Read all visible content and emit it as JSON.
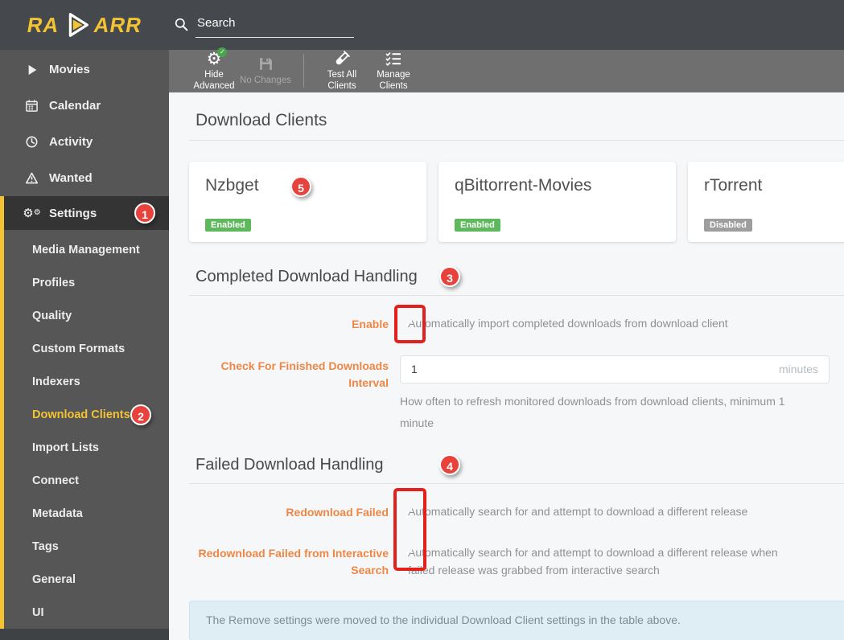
{
  "header": {
    "logo_left": "RA",
    "logo_right": "ARR",
    "search_placeholder": "Search"
  },
  "toolbar": {
    "buttons": [
      {
        "label": "Hide Advanced",
        "icon": "advanced-settings-icon",
        "state": "enabled"
      },
      {
        "label": "No Changes",
        "icon": "save-icon",
        "state": "disabled"
      },
      {
        "label": "Test All Clients",
        "icon": "test-tube-icon",
        "state": "enabled"
      },
      {
        "label": "Manage Clients",
        "icon": "checklist-icon",
        "state": "enabled"
      }
    ]
  },
  "sidebar": {
    "items": [
      {
        "label": "Movies",
        "icon": "play-icon"
      },
      {
        "label": "Calendar",
        "icon": "calendar-icon"
      },
      {
        "label": "Activity",
        "icon": "clock-icon"
      },
      {
        "label": "Wanted",
        "icon": "warning-icon"
      },
      {
        "label": "Settings",
        "icon": "gears-icon",
        "active": true
      }
    ],
    "settings_submenu": [
      {
        "label": "Media Management"
      },
      {
        "label": "Profiles"
      },
      {
        "label": "Quality"
      },
      {
        "label": "Custom Formats"
      },
      {
        "label": "Indexers"
      },
      {
        "label": "Download Clients",
        "selected": true
      },
      {
        "label": "Import Lists"
      },
      {
        "label": "Connect"
      },
      {
        "label": "Metadata"
      },
      {
        "label": "Tags"
      },
      {
        "label": "General"
      },
      {
        "label": "UI"
      }
    ]
  },
  "page": {
    "title": "Download Clients"
  },
  "download_clients": [
    {
      "name": "Nzbget",
      "status": "Enabled"
    },
    {
      "name": "qBittorrent-Movies",
      "status": "Enabled"
    },
    {
      "name": "rTorrent",
      "status": "Disabled"
    }
  ],
  "completed_section": {
    "title": "Completed Download Handling",
    "enable": {
      "label": "Enable",
      "checked": true,
      "help": "Automatically import completed downloads from download client"
    },
    "interval": {
      "label": "Check For Finished Downloads Interval",
      "value": "1",
      "unit": "minutes",
      "help": "How often to refresh monitored downloads from download clients, minimum 1 minute"
    }
  },
  "failed_section": {
    "title": "Failed Download Handling",
    "redownload": {
      "label": "Redownload Failed",
      "checked": true,
      "help": "Automatically search for and attempt to download a different release"
    },
    "redownload_interactive": {
      "label": "Redownload Failed from Interactive Search",
      "checked": true,
      "help": "Automatically search for and attempt to download a different release when failed release was grabbed from interactive search"
    }
  },
  "info_banner": {
    "text": "The Remove settings were moved to the individual Download Client settings in the table above."
  },
  "annotations": {
    "circles": [
      "1",
      "2",
      "3",
      "4",
      "5"
    ]
  },
  "colors": {
    "accent_yellow": "#f3c334",
    "label_orange": "#ee8745",
    "checkbox_blue": "#7b94d9",
    "enabled_green": "#5eb95c",
    "disabled_gray": "#9e9e9e",
    "annotation_red": "#e8423c",
    "info_bg": "#dfeef5"
  }
}
